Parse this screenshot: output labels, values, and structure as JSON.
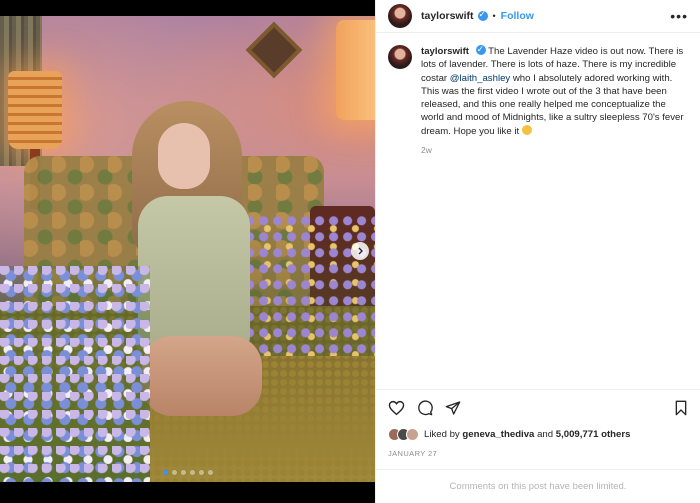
{
  "header": {
    "username": "taylorswift",
    "separator": "•",
    "follow_label": "Follow",
    "more_label": "•••"
  },
  "caption": {
    "username": "taylorswift",
    "text_before_mention": "The Lavender Haze video is out now. There is lots of lavender. There is lots of haze. There is my incredible costar ",
    "mention": "@laith_ashley",
    "text_after_mention": " who I absolutely adored working with. This was the first video I wrote out of the 3 that have been released, and this one really helped me conceptualize the world and mood of Midnights, like a sultry sleepless 70's fever dream. Hope you like it ",
    "time_ago": "2w"
  },
  "likes": {
    "prefix": "Liked by ",
    "liker": "geneva_thediva",
    "middle": " and ",
    "count": "5,009,771 others"
  },
  "post_date": "JANUARY 27",
  "comments_limited": "Comments on this post have been limited.",
  "carousel": {
    "total": 6,
    "active_index": 0
  },
  "icons": [
    "heart-icon",
    "comment-icon",
    "share-icon",
    "bookmark-icon",
    "verified-icon",
    "chevron-right-icon"
  ],
  "colors": {
    "accent": "#3897f0",
    "text": "#262626",
    "muted": "#8e8e8e",
    "mention": "#00376b"
  }
}
